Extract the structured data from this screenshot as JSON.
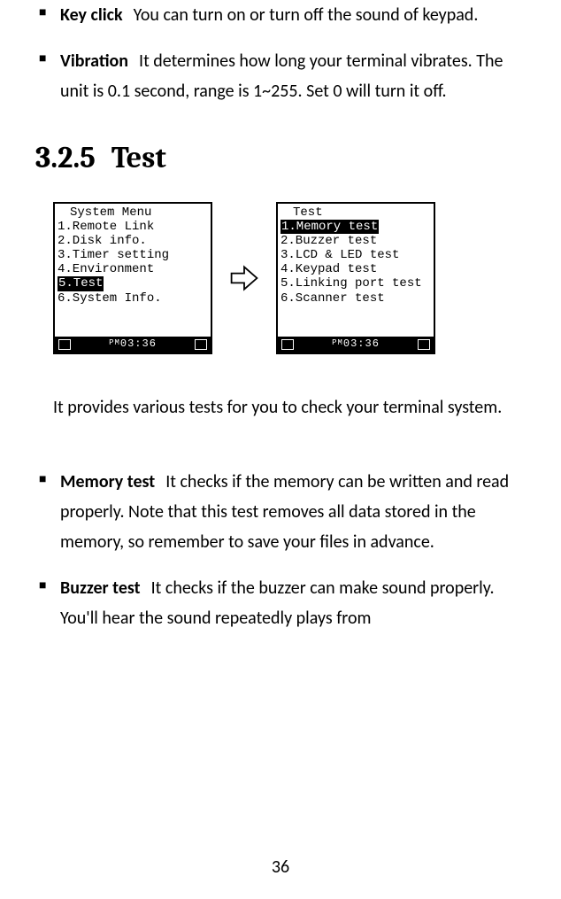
{
  "top_bullets": [
    {
      "term": "Key click",
      "body": "You can turn on or turn off the sound of keypad."
    },
    {
      "term": "Vibration",
      "body": "It determines how long your terminal vibrates. The unit is 0.1 second, range is 1~255. Set 0 will turn it off."
    }
  ],
  "heading": {
    "number": "3.2.5",
    "title": "Test"
  },
  "screen_left": {
    "title": "System Menu",
    "items": [
      {
        "text": "1.Remote Link",
        "selected": false
      },
      {
        "text": "2.Disk info.",
        "selected": false
      },
      {
        "text": "3.Timer setting",
        "selected": false
      },
      {
        "text": "4.Environment",
        "selected": false
      },
      {
        "text": "5.Test",
        "selected": true
      },
      {
        "text": "6.System Info.",
        "selected": false
      }
    ],
    "status_time": "03:36"
  },
  "screen_right": {
    "title": "Test",
    "items": [
      {
        "text": "1.Memory test",
        "selected": true
      },
      {
        "text": "2.Buzzer test",
        "selected": false
      },
      {
        "text": "3.LCD & LED test",
        "selected": false
      },
      {
        "text": "4.Keypad test",
        "selected": false
      },
      {
        "text": "5.Linking port test",
        "selected": false
      },
      {
        "text": "6.Scanner test",
        "selected": false
      }
    ],
    "status_time": "03:36"
  },
  "description": "It provides various tests for you to check your terminal system.",
  "bottom_bullets": [
    {
      "term": "Memory test",
      "body": "It checks if the memory can be written and read properly. Note that this test removes all data stored in the memory, so remember to save your files in advance."
    },
    {
      "term": "Buzzer test",
      "body": "It checks if the buzzer can make sound properly. You'll hear the sound repeatedly plays from"
    }
  ],
  "page_number": "36"
}
